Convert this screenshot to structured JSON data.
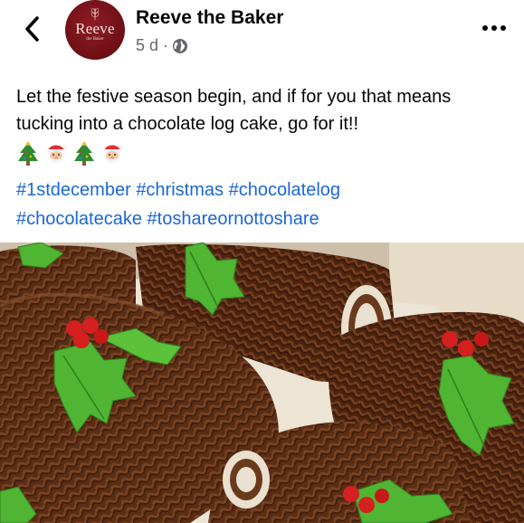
{
  "header": {
    "page_name": "Reeve the Baker",
    "time_ago": "5 d ·",
    "avatar_logo_text": "Reeve",
    "avatar_logo_subtext": "the Baker",
    "back_icon": "chevron-left-icon",
    "more_icon": "more-horizontal-icon",
    "privacy_icon": "globe-icon"
  },
  "post": {
    "caption": "Let the festive season begin, and if for you that means tucking into a chocolate log cake, go for it!!",
    "emojis": [
      "christmas-tree-emoji",
      "santa-emoji",
      "christmas-tree-emoji",
      "santa-emoji"
    ],
    "hashtags": [
      "#1stdecember",
      "#christmas",
      "#chocolatelog",
      "#chocolatecake",
      "#toshareornottoshare"
    ]
  },
  "colors": {
    "link": "#1b66d6",
    "meta_gray": "#65676b",
    "avatar_red": "#6e0f16",
    "chocolate": "#5a2d15",
    "holly_green": "#4fb532",
    "berry_red": "#d61f1f"
  }
}
